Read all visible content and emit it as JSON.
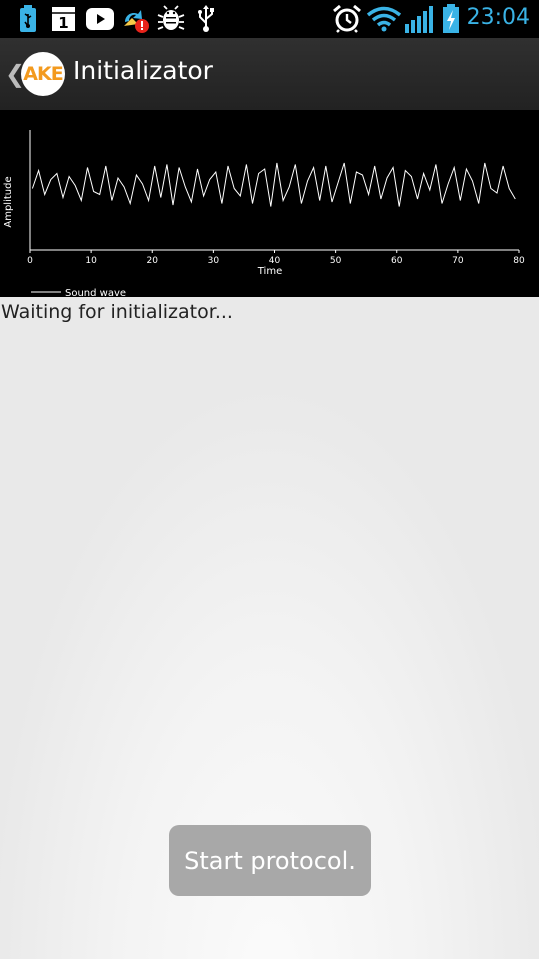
{
  "status_bar": {
    "time": "23:04",
    "icons": [
      "usb-storage-icon",
      "calendar-icon",
      "youtube-icon",
      "sync-warning-icon",
      "android-debug-icon",
      "usb-icon",
      "alarm-icon",
      "wifi-icon",
      "signal-icon",
      "battery-charging-icon"
    ],
    "calendar_day": "1",
    "accent_color": "#3ab3e6"
  },
  "action_bar": {
    "logo_text": "AKE",
    "title": "Initializator",
    "logo_color": "#f39a1e"
  },
  "chart_data": {
    "type": "line",
    "title": "",
    "xlabel": "Time",
    "ylabel": "Amplitude",
    "xlim": [
      0,
      80
    ],
    "xticks": [
      0,
      10,
      20,
      30,
      40,
      50,
      60,
      70,
      80
    ],
    "legend": "bottom-left",
    "series": [
      {
        "name": "Sound wave",
        "x": [
          0,
          1,
          2,
          3,
          4,
          5,
          6,
          7,
          8,
          9,
          10,
          11,
          12,
          13,
          14,
          15,
          16,
          17,
          18,
          19,
          20,
          21,
          22,
          23,
          24,
          25,
          26,
          27,
          28,
          29,
          30,
          31,
          32,
          33,
          34,
          35,
          36,
          37,
          38,
          39,
          40,
          41,
          42,
          43,
          44,
          45,
          46,
          47,
          48,
          49,
          50,
          51,
          52,
          53,
          54,
          55,
          56,
          57,
          58,
          59,
          60,
          61,
          62,
          63,
          64,
          65,
          66,
          67,
          68,
          69,
          70,
          71,
          72,
          73,
          74,
          75,
          76,
          77,
          78,
          79
        ],
        "y": [
          0.05,
          0.65,
          -0.15,
          0.35,
          0.55,
          -0.25,
          0.45,
          0.15,
          -0.35,
          0.75,
          -0.05,
          -0.15,
          0.8,
          -0.35,
          0.4,
          0.1,
          -0.45,
          0.5,
          0.2,
          -0.35,
          0.8,
          -0.25,
          0.85,
          -0.5,
          0.75,
          0.1,
          -0.4,
          0.7,
          -0.2,
          0.35,
          0.6,
          -0.45,
          0.8,
          0.05,
          -0.2,
          0.85,
          -0.45,
          0.55,
          0.7,
          -0.55,
          0.9,
          -0.35,
          0.1,
          0.85,
          -0.45,
          0.3,
          0.75,
          -0.35,
          0.8,
          -0.4,
          0.25,
          0.9,
          -0.45,
          0.6,
          0.5,
          -0.15,
          0.8,
          -0.3,
          0.4,
          0.75,
          -0.55,
          0.65,
          0.45,
          -0.3,
          0.55,
          0.0,
          0.85,
          -0.45,
          0.2,
          0.75,
          -0.35,
          0.7,
          0.3,
          -0.45,
          0.9,
          0.05,
          -0.1,
          0.8,
          0.05,
          -0.3
        ]
      }
    ]
  },
  "content": {
    "status_text": "Waiting for initializator..."
  },
  "toast": {
    "text": "Start protocol."
  }
}
